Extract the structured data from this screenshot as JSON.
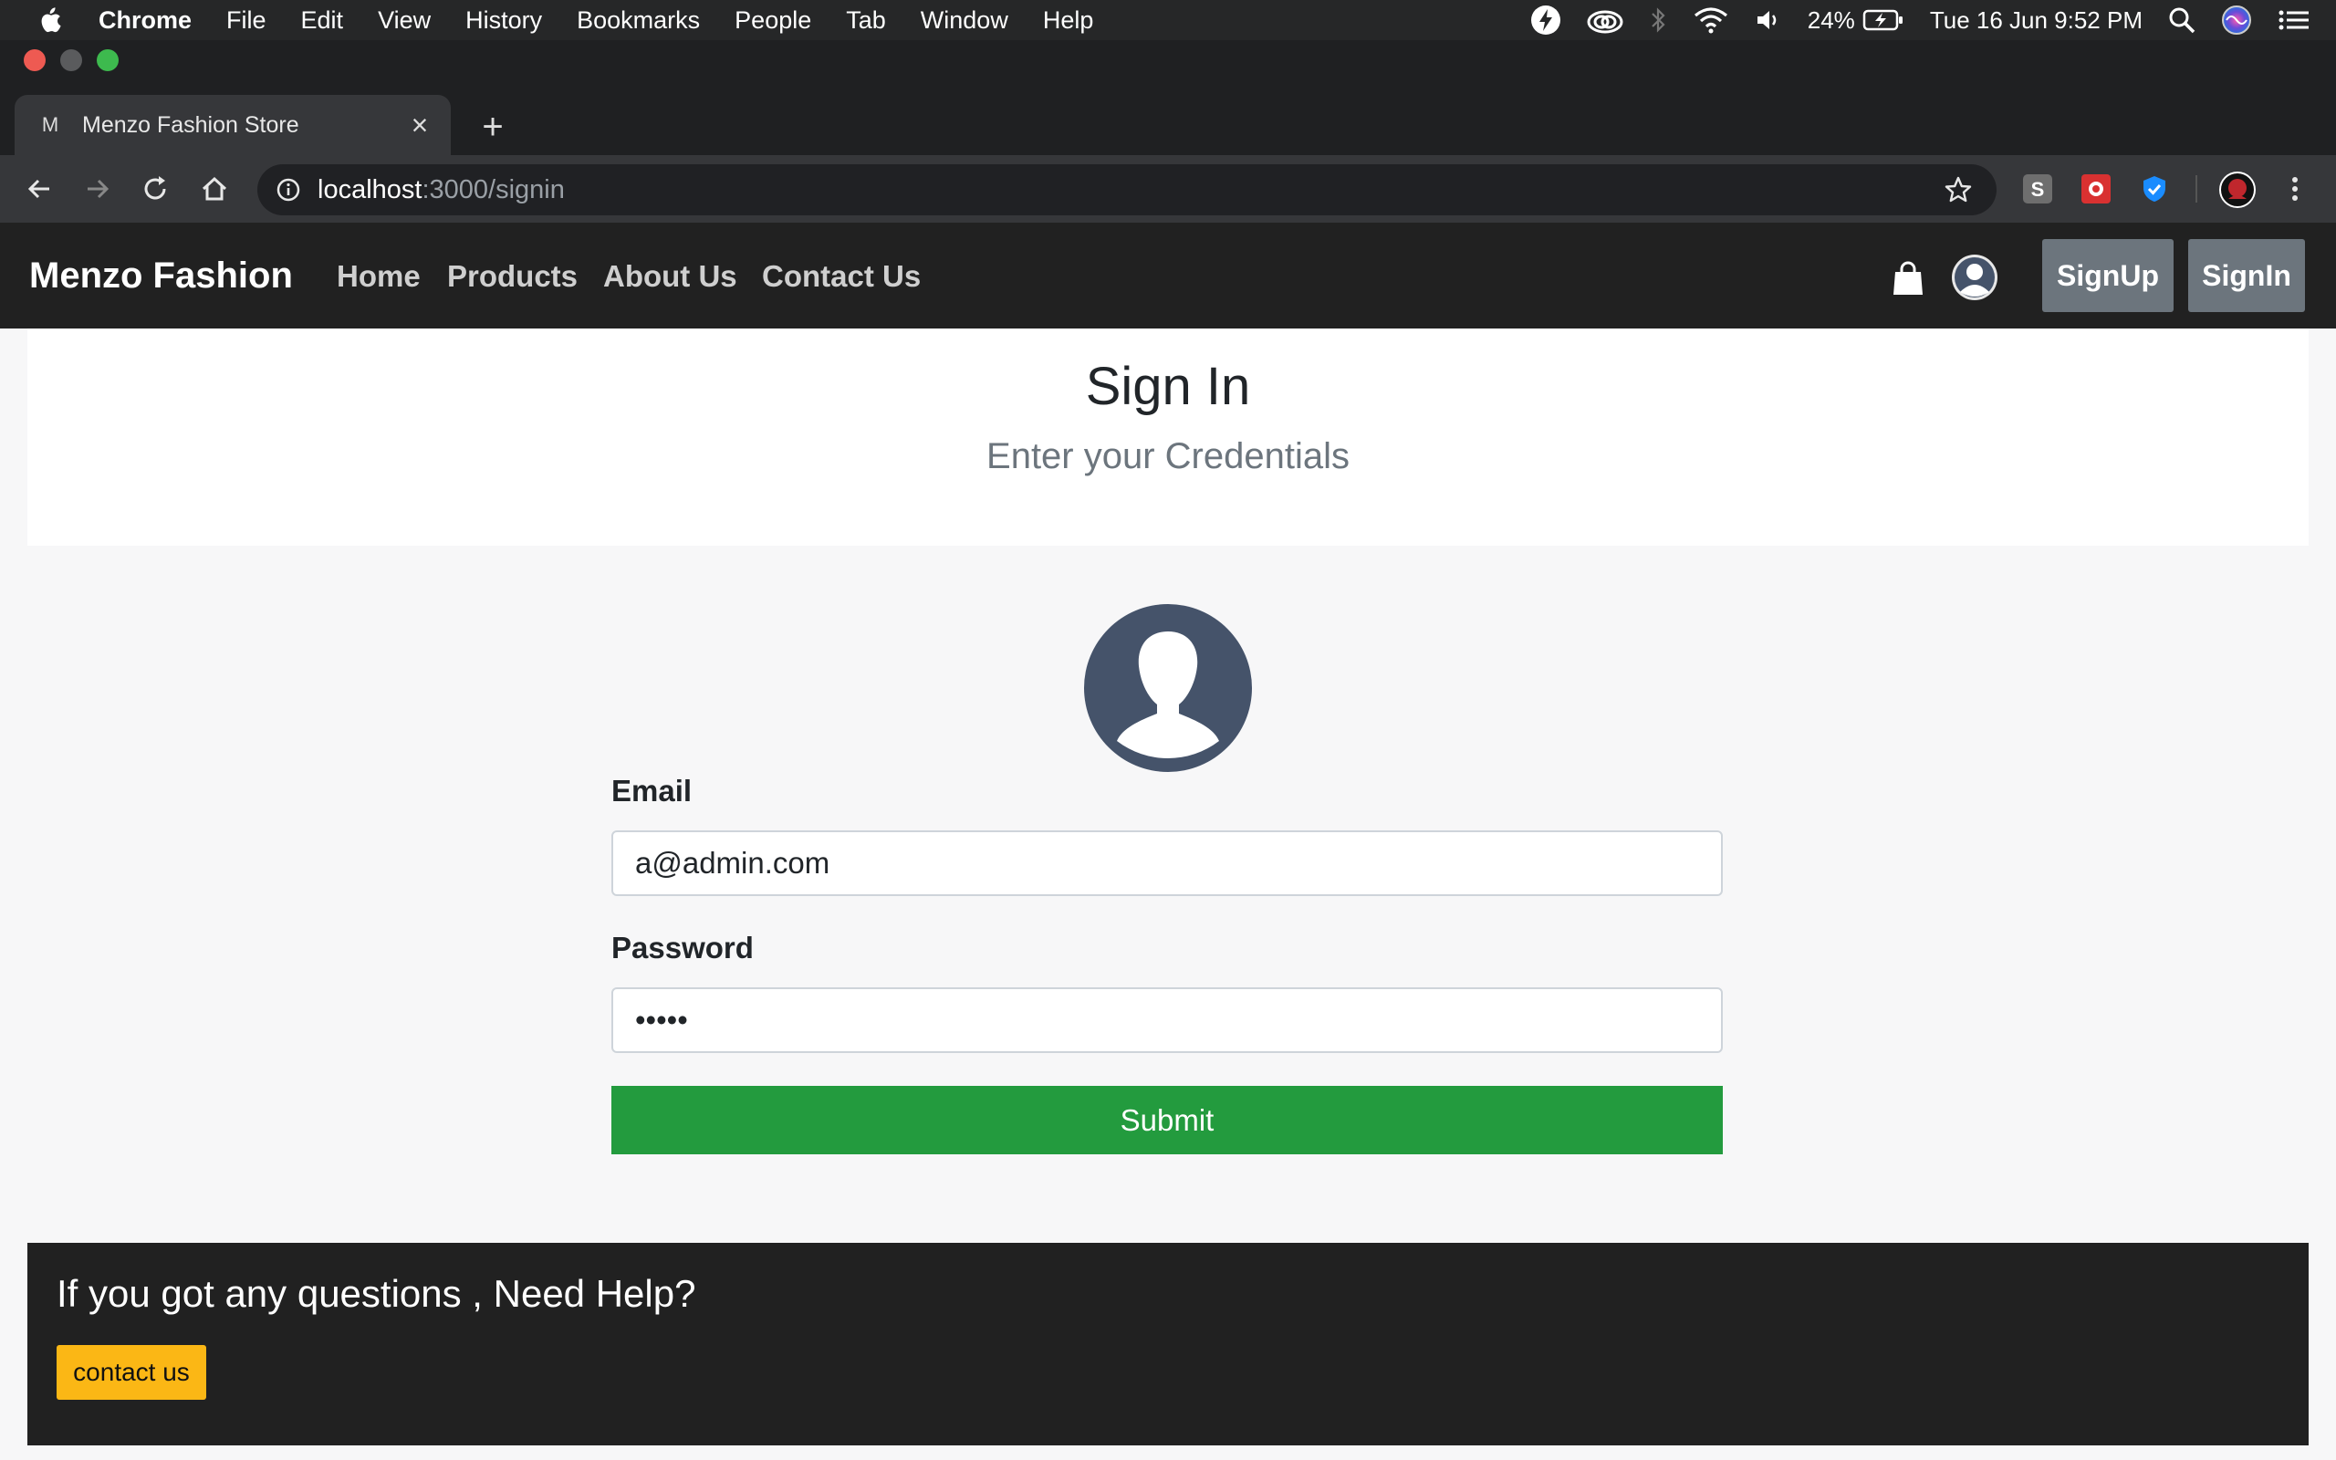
{
  "menubar": {
    "app_name": "Chrome",
    "items": [
      "File",
      "Edit",
      "View",
      "History",
      "Bookmarks",
      "People",
      "Tab",
      "Window",
      "Help"
    ],
    "battery": "24%",
    "datetime": "Tue 16 Jun  9:52 PM"
  },
  "browser": {
    "tab_title": "Menzo Fashion Store",
    "tab_favicon": "M",
    "url_host": "localhost",
    "url_path": ":3000/signin"
  },
  "site": {
    "brand": "Menzo Fashion",
    "nav": [
      "Home",
      "Products",
      "About Us",
      "Contact Us"
    ],
    "signup_label": "SignUp",
    "signin_label": "SignIn"
  },
  "jumbotron": {
    "title": "Sign In",
    "subtitle": "Enter your Credentials"
  },
  "form": {
    "email_label": "Email",
    "email_value": "a@admin.com",
    "password_label": "Password",
    "password_value": "•••••",
    "submit_label": "Submit"
  },
  "footer": {
    "question": "If you got any questions , Need Help?",
    "contact_label": "contact us"
  },
  "colors": {
    "navbar_bg": "#212121",
    "submit_green": "#239b3e",
    "contact_yellow": "#fbb715",
    "nav_button_gray": "#6c757d",
    "avatar_slate": "#45536a"
  }
}
